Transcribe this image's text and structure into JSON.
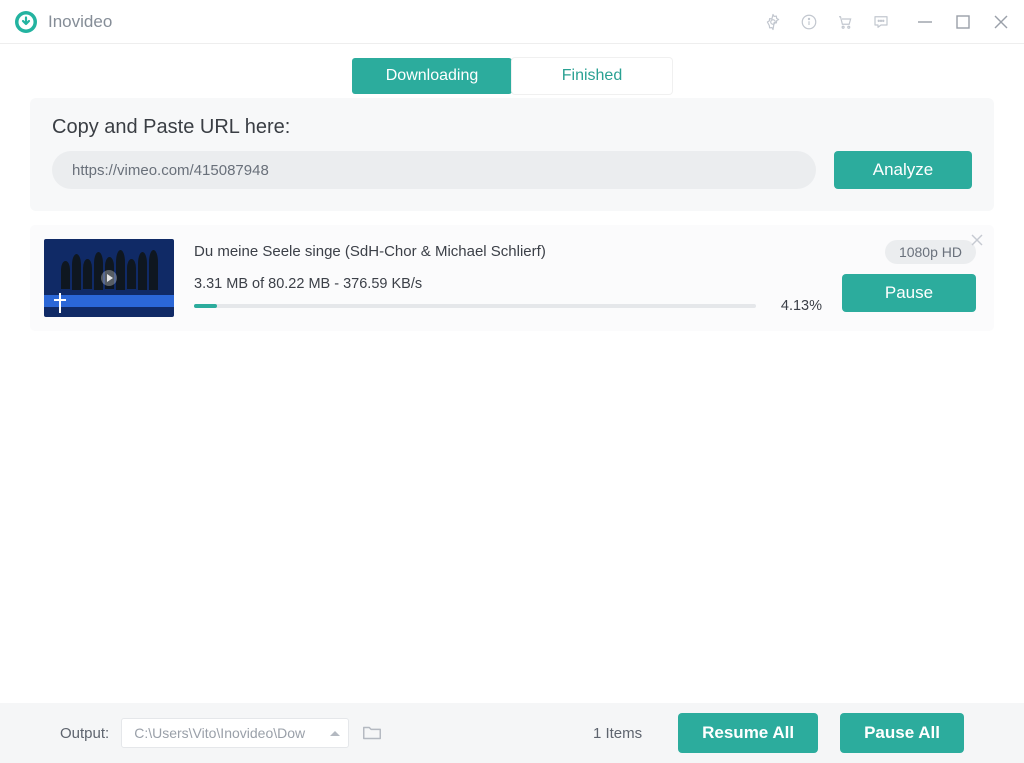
{
  "app": {
    "name": "Inovideo"
  },
  "tabs": {
    "downloading": "Downloading",
    "finished": "Finished"
  },
  "url_panel": {
    "label": "Copy and Paste URL here:",
    "value": "https://vimeo.com/415087948",
    "analyze": "Analyze"
  },
  "download_item": {
    "title": "Du meine Seele singe (SdH-Chor & Michael Schlierf)",
    "stats": "3.31 MB of 80.22 MB - 376.59 KB/s",
    "percent": "4.13%",
    "quality": "1080p HD",
    "pause": "Pause"
  },
  "footer": {
    "output_label": "Output:",
    "output_path": "C:\\Users\\Vito\\Inovideo\\Dow",
    "items": "1 Items",
    "resume_all": "Resume All",
    "pause_all": "Pause All"
  }
}
